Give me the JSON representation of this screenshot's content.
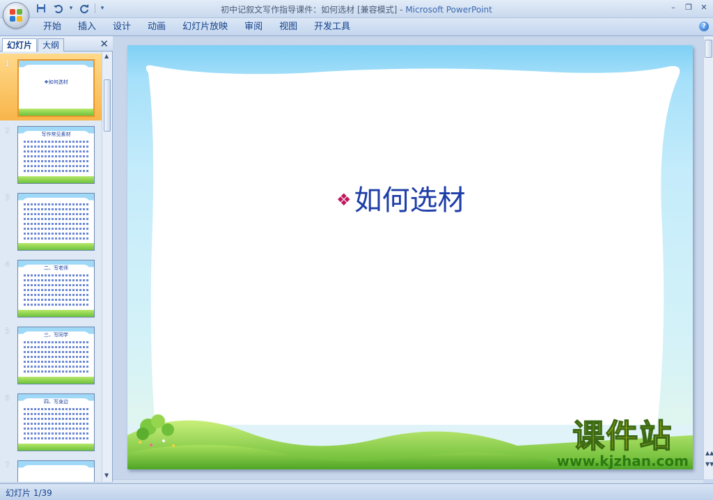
{
  "window": {
    "title": "初中记叙文写作指导课件：如何选材 [兼容模式] - ",
    "app_name": "Microsoft PowerPoint",
    "minimize": "–",
    "restore": "❐",
    "close": "✕"
  },
  "quick_access": {
    "save_icon": "💾",
    "undo_icon": "↶",
    "undo_dropdown": "▾",
    "redo_icon": "↻",
    "customize_icon": "▾"
  },
  "ribbon": {
    "tabs": [
      "开始",
      "插入",
      "设计",
      "动画",
      "幻灯片放映",
      "审阅",
      "视图",
      "开发工具"
    ],
    "help": "?"
  },
  "panel": {
    "tab_slides": "幻灯片",
    "tab_outline": "大纲",
    "close": "✕"
  },
  "thumbnails": [
    {
      "number": "1",
      "title": "❖如何选材"
    },
    {
      "number": "2",
      "title": "写作常见素材"
    },
    {
      "number": "3",
      "title": ""
    },
    {
      "number": "4",
      "title": "二、写老师"
    },
    {
      "number": "5",
      "title": "三、写同学"
    },
    {
      "number": "6",
      "title": "四、写身边"
    },
    {
      "number": "7",
      "title": ""
    }
  ],
  "slide": {
    "bullet": "❖",
    "title": "如何选材"
  },
  "watermark": {
    "main": "课件站",
    "url": "www.kjzhan.com"
  },
  "status": {
    "slide_indicator": "幻灯片 1/39"
  },
  "colors": {
    "title_text": "#1d3da8",
    "bullet": "#c0185e",
    "selected_thumb": "#f8b54a"
  }
}
